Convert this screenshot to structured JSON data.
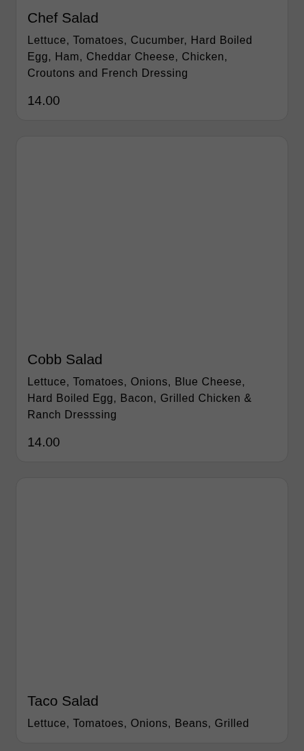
{
  "items": [
    {
      "name": "Chef Salad",
      "description": "Lettuce, Tomatoes, Cucumber, Hard Boiled Egg, Ham, Cheddar Cheese, Chicken, Croutons and French Dressing",
      "price": "14.00"
    },
    {
      "name": "Cobb Salad",
      "description": "Lettuce, Tomatoes, Onions, Blue Cheese, Hard Boiled Egg, Bacon, Grilled Chicken & Ranch Dresssing",
      "price": "14.00"
    },
    {
      "name": "Taco Salad",
      "description": "Lettuce, Tomatoes, Onions, Beans, Grilled"
    }
  ]
}
